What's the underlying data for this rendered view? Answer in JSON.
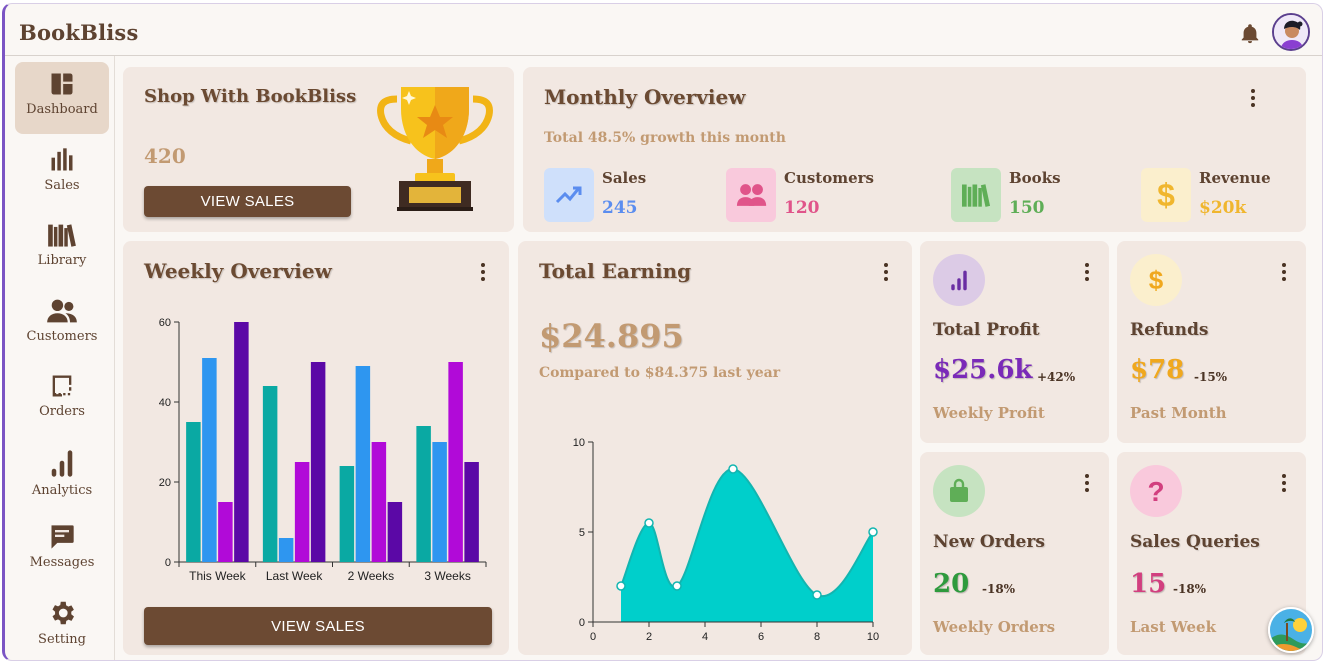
{
  "app": {
    "title": "BookBliss"
  },
  "sidebar": {
    "items": [
      {
        "label": "Dashboard",
        "icon": "dashboard-icon",
        "active": true
      },
      {
        "label": "Sales",
        "icon": "bar-chart-icon"
      },
      {
        "label": "Library",
        "icon": "books-icon"
      },
      {
        "label": "Customers",
        "icon": "people-icon"
      },
      {
        "label": "Orders",
        "icon": "orders-icon"
      },
      {
        "label": "Analytics",
        "icon": "analytics-icon"
      },
      {
        "label": "Messages",
        "icon": "message-icon"
      },
      {
        "label": "Setting",
        "icon": "gear-icon"
      }
    ]
  },
  "shop": {
    "title": "Shop With BookBliss",
    "value": "420",
    "button": "VIEW SALES"
  },
  "monthly": {
    "title": "Monthly Overview",
    "subtitle": "Total 48.5% growth this month",
    "stats": [
      {
        "label": "Sales",
        "value": "245",
        "color": "#5b8def",
        "bg": "#cfe0fb",
        "icon": "trending-up-icon"
      },
      {
        "label": "Customers",
        "value": "120",
        "color": "#e0548a",
        "bg": "#f9c9dc",
        "icon": "people-icon"
      },
      {
        "label": "Books",
        "value": "150",
        "color": "#5fae57",
        "bg": "#c6e3c1",
        "icon": "books-icon"
      },
      {
        "label": "Revenue",
        "value": "$20k",
        "color": "#f0b62e",
        "bg": "#fbefcd",
        "icon": "dollar-icon"
      }
    ]
  },
  "weekly": {
    "title": "Weekly Overview",
    "button": "VIEW SALES",
    "chart_data": {
      "type": "bar",
      "categories": [
        "This Week",
        "Last Week",
        "2 Weeks",
        "3 Weeks"
      ],
      "series": [
        {
          "values": [
            35,
            44,
            24,
            34
          ],
          "color": "#0aa9a3"
        },
        {
          "values": [
            51,
            6,
            49,
            30
          ],
          "color": "#2e96f0"
        },
        {
          "values": [
            15,
            25,
            30,
            50
          ],
          "color": "#b10ad8"
        },
        {
          "values": [
            60,
            50,
            15,
            25
          ],
          "color": "#5b08a6"
        }
      ],
      "ylim": [
        0,
        60
      ],
      "yticks": [
        0,
        20,
        40,
        60
      ]
    }
  },
  "earning": {
    "title": "Total Earning",
    "value": "$24.895",
    "compare": "Compared to $84.375 last year",
    "chart_data": {
      "type": "area",
      "x": [
        1,
        2,
        3,
        5,
        8,
        10
      ],
      "y": [
        2,
        5.5,
        2,
        8.5,
        1.5,
        5
      ],
      "xlim": [
        0,
        10
      ],
      "ylim": [
        0,
        10
      ],
      "xticks": [
        0,
        2,
        4,
        6,
        8,
        10
      ],
      "yticks": [
        0,
        5,
        10
      ],
      "color": "#00cfcb"
    }
  },
  "profit": {
    "title": "Total Profit",
    "value": "$25.6k",
    "change": "+42%",
    "sub": "Weekly Profit",
    "color": "#7a2ab8",
    "bg": "#dccbe6",
    "icon": "analytics-icon"
  },
  "refunds": {
    "title": "Refunds",
    "value": "$78",
    "change": "-15%",
    "sub": "Past Month",
    "color": "#f0a81e",
    "bg": "#fbefcd",
    "icon": "dollar-icon"
  },
  "orders": {
    "title": "New Orders",
    "value": "20",
    "change": "-18%",
    "sub": "Weekly Orders",
    "color": "#2e9a3d",
    "bg": "#c6e3c1",
    "icon": "shopping-bag-icon"
  },
  "queries": {
    "title": "Sales Queries",
    "value": "15",
    "change": "-18%",
    "sub": "Last Week",
    "color": "#d23f7f",
    "bg": "#f9c9dc",
    "icon": "question-icon"
  }
}
